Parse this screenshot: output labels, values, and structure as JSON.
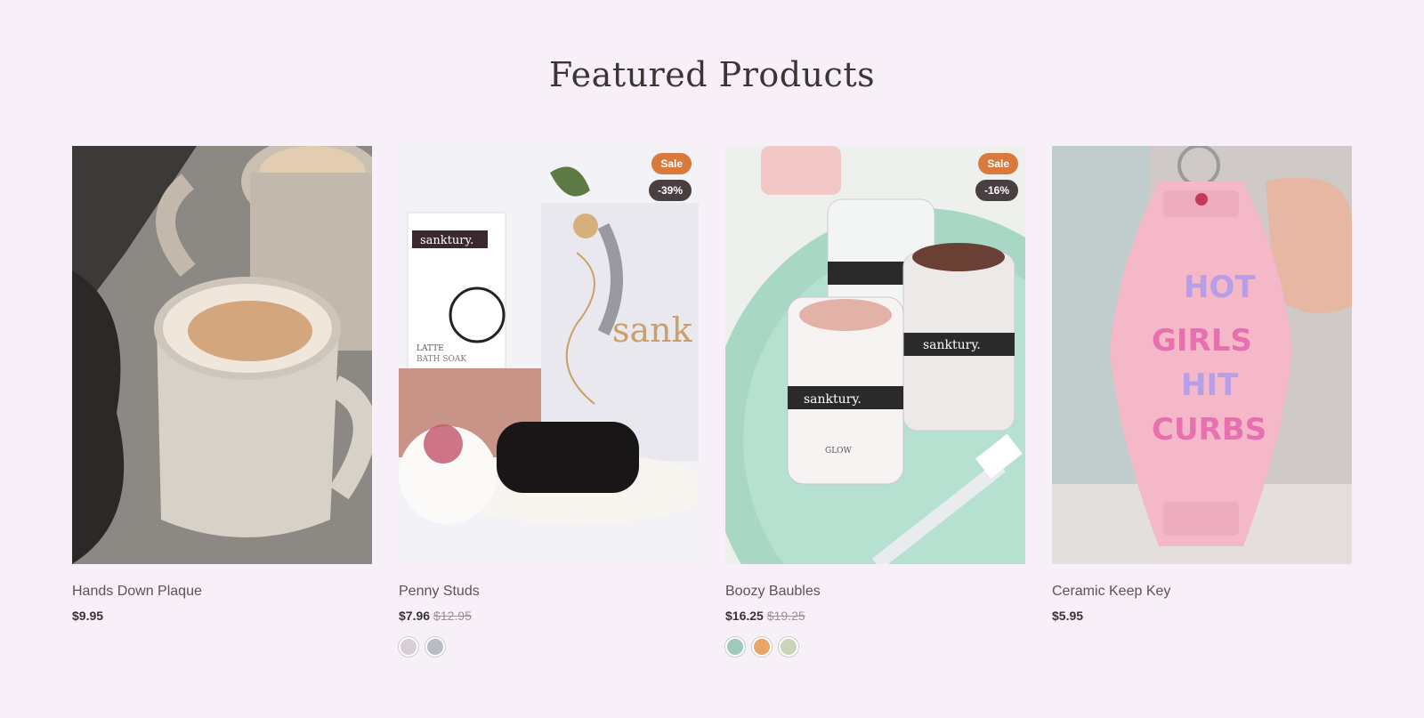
{
  "section": {
    "title": "Featured Products"
  },
  "products": [
    {
      "title": "Hands Down Plaque",
      "price": "$9.95",
      "compare_price": "",
      "image": "coffee-mugs-photo"
    },
    {
      "title": "Penny Studs",
      "price": "$7.96",
      "compare_price": "$12.95",
      "sale_badge": "Sale",
      "discount_badge": "-39%",
      "image": "bath-soak-gift-set-photo",
      "swatches": [
        "#d8cfd6",
        "#b9bcc2"
      ]
    },
    {
      "title": "Boozy Baubles",
      "price": "$16.25",
      "compare_price": "$19.25",
      "sale_badge": "Sale",
      "discount_badge": "-16%",
      "image": "clay-mask-jars-photo",
      "swatches": [
        "#9fc9b8",
        "#e7a56a",
        "#c9d4b8"
      ]
    },
    {
      "title": "Ceramic Keep Key",
      "price": "$5.95",
      "compare_price": "",
      "image": "pink-motel-keychain-photo"
    }
  ],
  "images": {
    "jar_label": "sanktury.",
    "box_text": "sank",
    "soak_label_1": "LATTE",
    "soak_label_2": "BATH SOAK",
    "glow_label": "GLOW",
    "keychain_lines": [
      "HOT",
      "GIRLS",
      "HIT",
      "CURBS"
    ]
  },
  "colors": {
    "background": "#f7f0f8",
    "sale_badge": "#d97a3c",
    "discount_badge": "#4a3f40"
  }
}
